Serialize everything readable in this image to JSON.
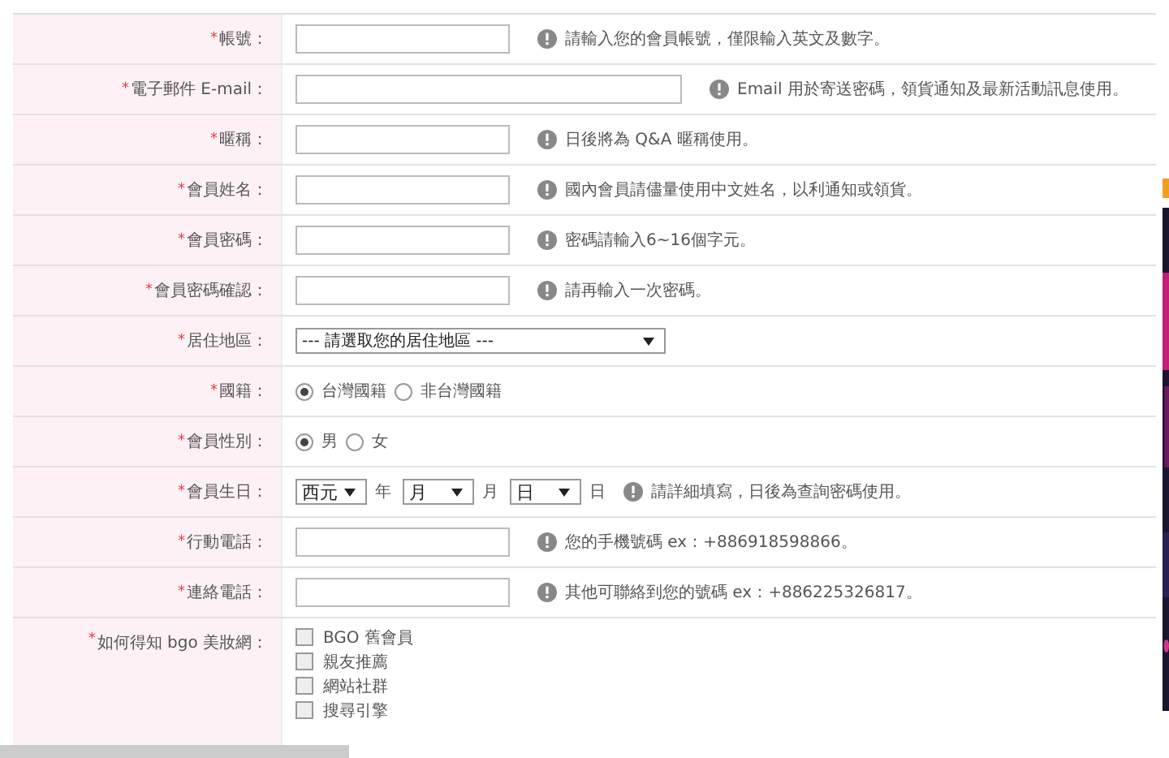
{
  "rows": [
    {
      "kind": "text",
      "mark": "*",
      "label": "帳號：",
      "hint": "請輸入您的會員帳號，僅限輸入英文及數字。",
      "wide": false
    },
    {
      "kind": "text",
      "mark": "*",
      "label": "電子郵件 E-mail：",
      "hint": "Email 用於寄送密碼，領貨通知及最新活動訊息使用。",
      "wide": true
    },
    {
      "kind": "text",
      "mark": "*",
      "label": "暱稱：",
      "hint": "日後將為 Q&A 暱稱使用。",
      "wide": false
    },
    {
      "kind": "text",
      "mark": "*",
      "label": "會員姓名：",
      "hint": "國內會員請儘量使用中文姓名，以利通知或領貨。",
      "wide": false
    },
    {
      "kind": "text",
      "mark": "*",
      "label": "會員密碼：",
      "hint": "密碼請輸入6~16個字元。",
      "wide": false
    },
    {
      "kind": "text",
      "mark": "*",
      "label": "會員密碼確認：",
      "hint": "請再輸入一次密碼。",
      "wide": false
    },
    {
      "kind": "select",
      "mark": "*",
      "label": "居住地區：",
      "value": "--- 請選取您的居住地區 ---"
    },
    {
      "kind": "radio",
      "mark": "*",
      "label": "國籍：",
      "options": [
        {
          "label": "台灣國籍",
          "selected": true
        },
        {
          "label": "非台灣國籍",
          "selected": false
        }
      ]
    },
    {
      "kind": "radio",
      "mark": "*",
      "label": "會員性別：",
      "options": [
        {
          "label": "男",
          "selected": true
        },
        {
          "label": "女",
          "selected": false
        }
      ]
    },
    {
      "kind": "date",
      "mark": "*",
      "label": "會員生日：",
      "parts": [
        {
          "value": "西元",
          "unit": "年"
        },
        {
          "value": "月",
          "unit": "月"
        },
        {
          "value": "日",
          "unit": "日"
        }
      ],
      "hint": "請詳細填寫，日後為查詢密碼使用。"
    },
    {
      "kind": "text",
      "mark": "*",
      "label": "行動電話：",
      "hint": "您的手機號碼 ex：+886918598866。",
      "wide": false
    },
    {
      "kind": "text",
      "mark": "*",
      "label": "連絡電話：",
      "hint": "其他可聯絡到您的號碼 ex：+886225326817。",
      "wide": false
    },
    {
      "kind": "checkbox",
      "mark": "*",
      "label": "如何得知 bgo 美妝網：",
      "options": [
        {
          "label": "BGO 舊會員",
          "checked": false
        },
        {
          "label": "親友推薦",
          "checked": false
        },
        {
          "label": "網站社群",
          "checked": false
        },
        {
          "label": "搜尋引擎",
          "checked": false
        }
      ]
    }
  ]
}
